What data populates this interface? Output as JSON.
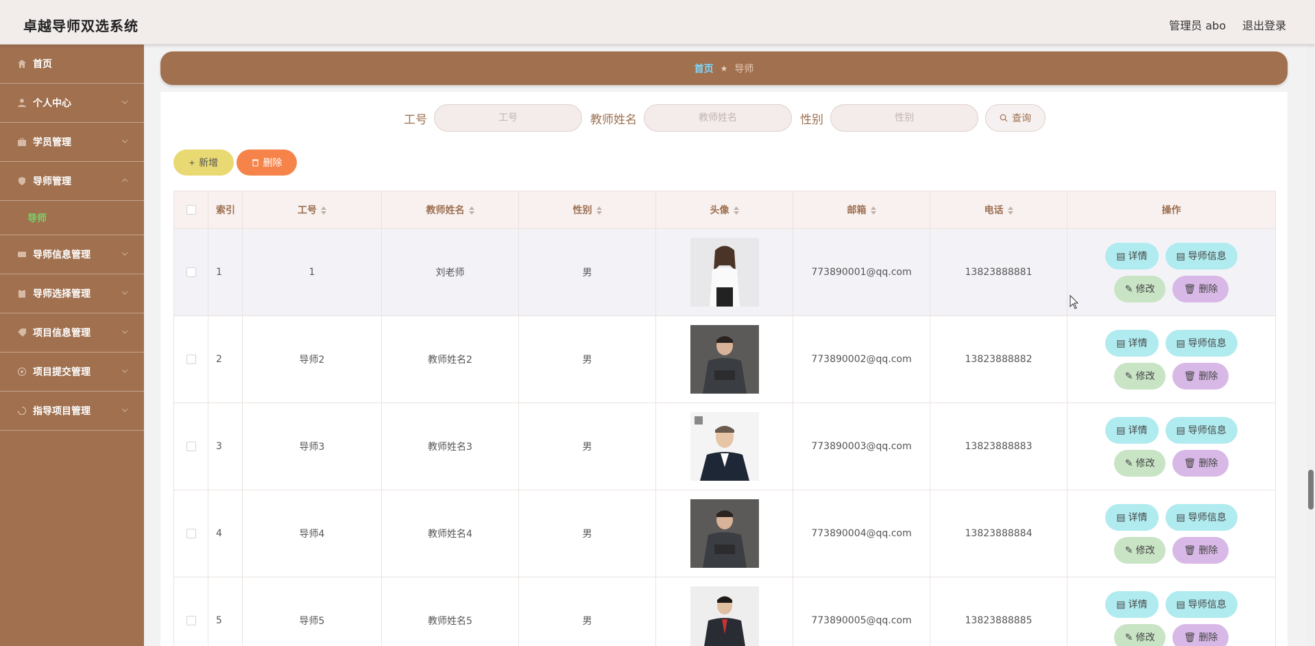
{
  "header": {
    "title": "卓越导师双选系统",
    "user_label": "管理员 abo",
    "logout_label": "退出登录"
  },
  "sidebar": {
    "items": [
      {
        "label": "首页",
        "icon": "home-icon",
        "chevron": false
      },
      {
        "label": "个人中心",
        "icon": "user-icon",
        "chevron": true
      },
      {
        "label": "学员管理",
        "icon": "briefcase-icon",
        "chevron": true
      },
      {
        "label": "导师管理",
        "icon": "shield-icon",
        "chevron": true,
        "expanded": true
      },
      {
        "label": "导师信息管理",
        "icon": "ticket-icon",
        "chevron": true
      },
      {
        "label": "导师选择管理",
        "icon": "clipboard-icon",
        "chevron": true
      },
      {
        "label": "项目信息管理",
        "icon": "tag-icon",
        "chevron": true
      },
      {
        "label": "项目提交管理",
        "icon": "target-icon",
        "chevron": true
      },
      {
        "label": "指导项目管理",
        "icon": "loading-icon",
        "chevron": true
      }
    ],
    "submenu": {
      "label": "导师",
      "color": "#7bd16a"
    }
  },
  "breadcrumb": {
    "home": "首页",
    "current": "导师"
  },
  "search": {
    "fields": [
      {
        "label": "工号",
        "placeholder": "工号"
      },
      {
        "label": "教师姓名",
        "placeholder": "教师姓名"
      },
      {
        "label": "性别",
        "placeholder": "性别"
      }
    ],
    "button_label": "查询"
  },
  "actions": {
    "add_label": "新增",
    "delete_label": "删除"
  },
  "table": {
    "columns": [
      "索引",
      "工号",
      "教师姓名",
      "性别",
      "头像",
      "邮箱",
      "电话",
      "操作"
    ],
    "rows": [
      {
        "index": "1",
        "id": "1",
        "name": "刘老师",
        "gender": "男",
        "email": "773890001@qq.com",
        "phone": "13823888881"
      },
      {
        "index": "2",
        "id": "导师2",
        "name": "教师姓名2",
        "gender": "男",
        "email": "773890002@qq.com",
        "phone": "13823888882"
      },
      {
        "index": "3",
        "id": "导师3",
        "name": "教师姓名3",
        "gender": "男",
        "email": "773890003@qq.com",
        "phone": "13823888883"
      },
      {
        "index": "4",
        "id": "导师4",
        "name": "教师姓名4",
        "gender": "男",
        "email": "773890004@qq.com",
        "phone": "13823888884"
      },
      {
        "index": "5",
        "id": "导师5",
        "name": "教师姓名5",
        "gender": "男",
        "email": "773890005@qq.com",
        "phone": "13823888885"
      }
    ],
    "row_actions": {
      "detail": "详情",
      "info": "导师信息",
      "edit": "修改",
      "delete": "删除"
    }
  },
  "colors": {
    "brand_brown": "#a0704f",
    "header_bg": "#f2eceb",
    "active_green": "#7bd16a",
    "add_yellow": "#e8d972",
    "delete_orange": "#f6844a"
  }
}
